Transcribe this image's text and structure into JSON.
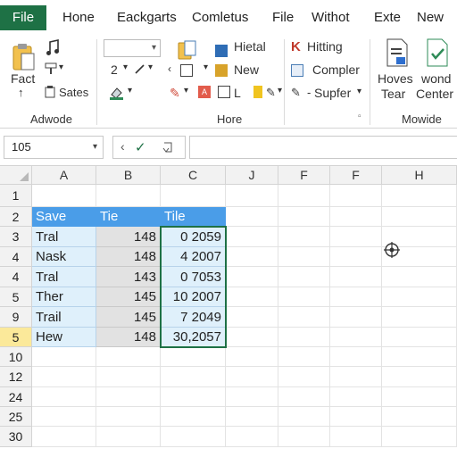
{
  "tabs": {
    "file": "File",
    "items": [
      "Hone",
      "Eackgarts",
      "Comletus",
      "File",
      "Withot",
      "Exte",
      "New"
    ]
  },
  "ribbon": {
    "g1": {
      "fact": "Fact",
      "up": "↑",
      "sates": "Sates",
      "label": "Adwode"
    },
    "g2": {
      "num": "2",
      "hietal": "Hietal",
      "new": "New",
      "l": "L",
      "label": "Hore"
    },
    "g3": {
      "hitting": "Hitting",
      "compler": "Compler",
      "supfer": "Supfer"
    },
    "g4": {
      "hoves": "Hoves",
      "tear": "Tear",
      "wond": "wond",
      "center": "Center",
      "label": "Mowide"
    }
  },
  "formula_bar": {
    "name_box": "105",
    "formula": ""
  },
  "grid": {
    "columns": [
      "A",
      "B",
      "C",
      "J",
      "F",
      "F",
      "H"
    ],
    "rows": [
      "1",
      "2",
      "3",
      "4",
      "4",
      "5",
      "9",
      "5",
      "10",
      "12",
      "24",
      "25",
      "30"
    ],
    "active_row": "5",
    "table_header": [
      "Save",
      "Tie",
      "Tile"
    ],
    "table_rows": [
      [
        "Tral",
        "148",
        "0 2059"
      ],
      [
        "Nask",
        "148",
        "4 2007"
      ],
      [
        "Tral",
        "143",
        "0 7053"
      ],
      [
        "Ther",
        "145",
        "10 2007"
      ],
      [
        "Trail",
        "145",
        "7 2049"
      ],
      [
        "Hew",
        "148",
        "30,2057"
      ]
    ]
  },
  "colors": {
    "accent": "#1e7145",
    "table_header": "#4a9de8",
    "table_fill": "#dff0fb",
    "active_row": "#fbe99a"
  }
}
